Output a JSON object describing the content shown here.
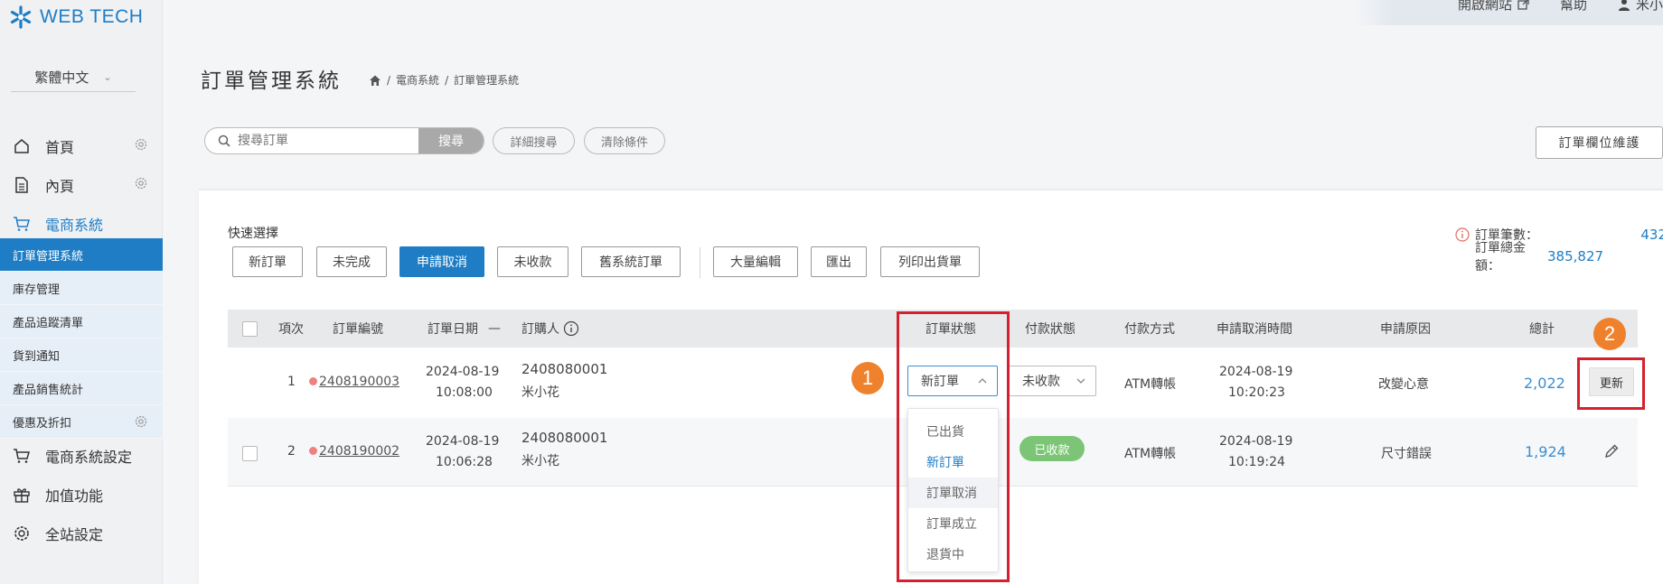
{
  "brand": {
    "logo_text": "WEB TECH",
    "accent": "#1e7dc4"
  },
  "topbar": {
    "open_site": "開啟網站",
    "help": "幫助",
    "user": "米小"
  },
  "language": {
    "value": "繁體中文"
  },
  "sidebar": {
    "top_items": [
      {
        "label": "首頁",
        "icon": "home-icon"
      },
      {
        "label": "內頁",
        "icon": "page-icon"
      },
      {
        "label": "電商系統",
        "icon": "cart-icon"
      }
    ],
    "sub_items": [
      {
        "label": "訂單管理系統"
      },
      {
        "label": "庫存管理"
      },
      {
        "label": "產品追蹤清單"
      },
      {
        "label": "貨到通知"
      },
      {
        "label": "產品銷售統計"
      },
      {
        "label": "優惠及折扣"
      }
    ],
    "bottom_items": [
      {
        "label": "電商系統設定",
        "icon": "cart-icon"
      },
      {
        "label": "加值功能",
        "icon": "gift-icon"
      },
      {
        "label": "全站設定",
        "icon": "gear-icon"
      }
    ]
  },
  "header": {
    "title": "訂單管理系統",
    "breadcrumb": [
      "電商系統",
      "訂單管理系統"
    ]
  },
  "search": {
    "placeholder": "搜尋訂單",
    "button": "搜尋",
    "advanced": "詳細搜尋",
    "clear": "清除條件"
  },
  "column_maintenance": "訂單欄位維護",
  "quick": {
    "label": "快速選擇",
    "buttons": [
      "新訂單",
      "未完成",
      "申請取消",
      "未收款",
      "舊系統訂單"
    ],
    "buttons2": [
      "大量編輯",
      "匯出",
      "列印出貨單"
    ]
  },
  "stats": {
    "count_label": "訂單筆數：",
    "count_value": "432",
    "total_label": "訂單總金額：",
    "total_value": "385,827"
  },
  "table": {
    "headers": [
      "項次",
      "訂單編號",
      "訂單日期",
      "—",
      "訂購人",
      "訂單狀態",
      "付款狀態",
      "付款方式",
      "申請取消時間",
      "申請原因",
      "總計"
    ],
    "rows": [
      {
        "index": "1",
        "order_no": "2408190003",
        "date": "2024-08-19",
        "time": "10:08:00",
        "member_id": "2408080001",
        "buyer": "米小花",
        "status": "新訂單",
        "payment_status": "未收款",
        "payment_method": "ATM轉帳",
        "cancel_date": "2024-08-19",
        "cancel_time": "10:20:23",
        "reason": "改變心意",
        "total": "2,022",
        "action": "更新"
      },
      {
        "index": "2",
        "order_no": "2408190002",
        "date": "2024-08-19",
        "time": "10:06:28",
        "member_id": "2408080001",
        "buyer": "米小花",
        "status": "",
        "payment_status": "已收款",
        "payment_method": "ATM轉帳",
        "cancel_date": "2024-08-19",
        "cancel_time": "10:19:24",
        "reason": "尺寸錯誤",
        "total": "1,924"
      }
    ]
  },
  "status_options": [
    "已出貨",
    "新訂單",
    "訂單取消",
    "訂單成立",
    "退貨中"
  ],
  "annotations": [
    "1",
    "2"
  ]
}
